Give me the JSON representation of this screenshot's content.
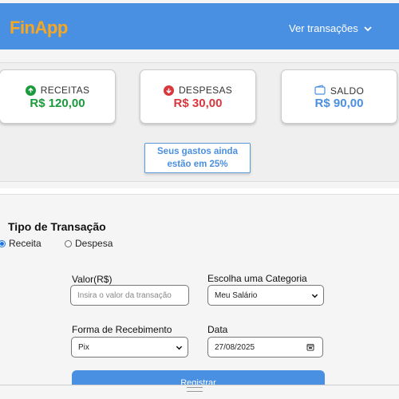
{
  "header": {
    "logo": "FinApp",
    "nav_link": "Ver transações",
    "colors": {
      "bar": "#4a90e2",
      "logo": "#f5a623"
    }
  },
  "summary": {
    "cards": [
      {
        "title": "RECEITAS",
        "value": "R$ 120,00",
        "icon": "arrow-up-circle-icon",
        "color": "#1a9a3b"
      },
      {
        "title": "DESPESAS",
        "value": "R$ 30,00",
        "icon": "arrow-down-circle-icon",
        "color": "#d9363e"
      },
      {
        "title": "SALDO",
        "value": "R$ 90,00",
        "icon": "wallet-icon",
        "color": "#4a8fe0"
      }
    ],
    "alert_line1": "Seus gastos ainda",
    "alert_line2": "estão em 25%"
  },
  "form": {
    "title": "Tipo de Transação",
    "type_options": [
      {
        "label": "Receita",
        "checked": true
      },
      {
        "label": "Despesa",
        "checked": false
      }
    ],
    "amount_label": "Valor(R$)",
    "amount_placeholder": "Insira o valor da transação",
    "category_label": "Escolha uma Categoria",
    "category_value": "Meu Salário",
    "payment_label": "Forma de Recebimento",
    "payment_value": "Pix",
    "date_label": "Data",
    "date_value": "27/08/2025",
    "submit_label": "Registrar"
  }
}
